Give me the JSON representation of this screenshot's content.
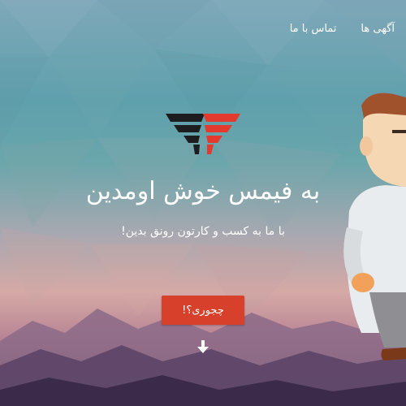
{
  "nav": {
    "items": [
      {
        "label": "آگهی ها"
      },
      {
        "label": "تماس با ما"
      }
    ]
  },
  "hero": {
    "title": "به فیمس خوش اومدین",
    "subtitle": "با ما به کسب و کارتون رونق بدین!",
    "cta_label": "چجوری؟!"
  },
  "colors": {
    "cta": "#d7402b",
    "logo_red": "#e43a2e",
    "logo_dark": "#1d1d1f"
  },
  "icons": {
    "logo": "famous-logo",
    "scroll": "arrow-down-icon",
    "mascot": "cartoon-character"
  }
}
